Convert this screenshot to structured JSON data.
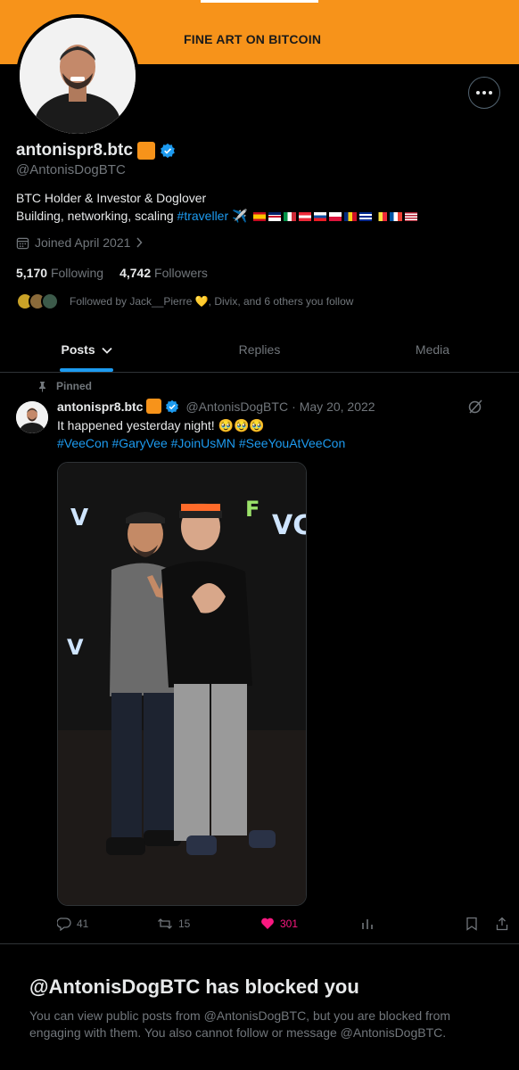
{
  "banner": {
    "text": "FINE ART ON BITCOIN",
    "color": "#f7931a"
  },
  "profile": {
    "display_name": "antonispr8.btc",
    "handle": "@AntonisDogBTC",
    "bio_line1": "BTC Holder & Investor & Doglover",
    "bio_line2": "Building, networking, scaling ",
    "bio_hashtag": "#traveller",
    "joined": "Joined April 2021",
    "following_count": "5,170",
    "following_label": "Following",
    "followers_count": "4,742",
    "followers_label": "Followers",
    "followed_by": "Followed by Jack__Pierre 💛, Divix, and 6 others you follow"
  },
  "tabs": [
    {
      "label": "Posts"
    },
    {
      "label": "Replies"
    },
    {
      "label": "Media"
    }
  ],
  "tweet": {
    "pinned_label": "Pinned",
    "author_name": "antonispr8.btc",
    "author_handle": "@AntonisDogBTC",
    "date": "May 20, 2022",
    "text": "It happened yesterday night! 🥹🥹🥹",
    "hashtags": "#VeeCon #GaryVee #JoinUsMN #SeeYouAtVeeCon",
    "replies": "41",
    "reposts": "15",
    "likes": "301"
  },
  "blocked": {
    "title": "@AntonisDogBTC has blocked you",
    "text": "You can view public posts from @AntonisDogBTC, but you are blocked from engaging with them. You also cannot follow or message @AntonisDogBTC."
  },
  "colors": {
    "accent": "#1d9bf0",
    "like": "#f91880",
    "muted": "#71767b"
  }
}
